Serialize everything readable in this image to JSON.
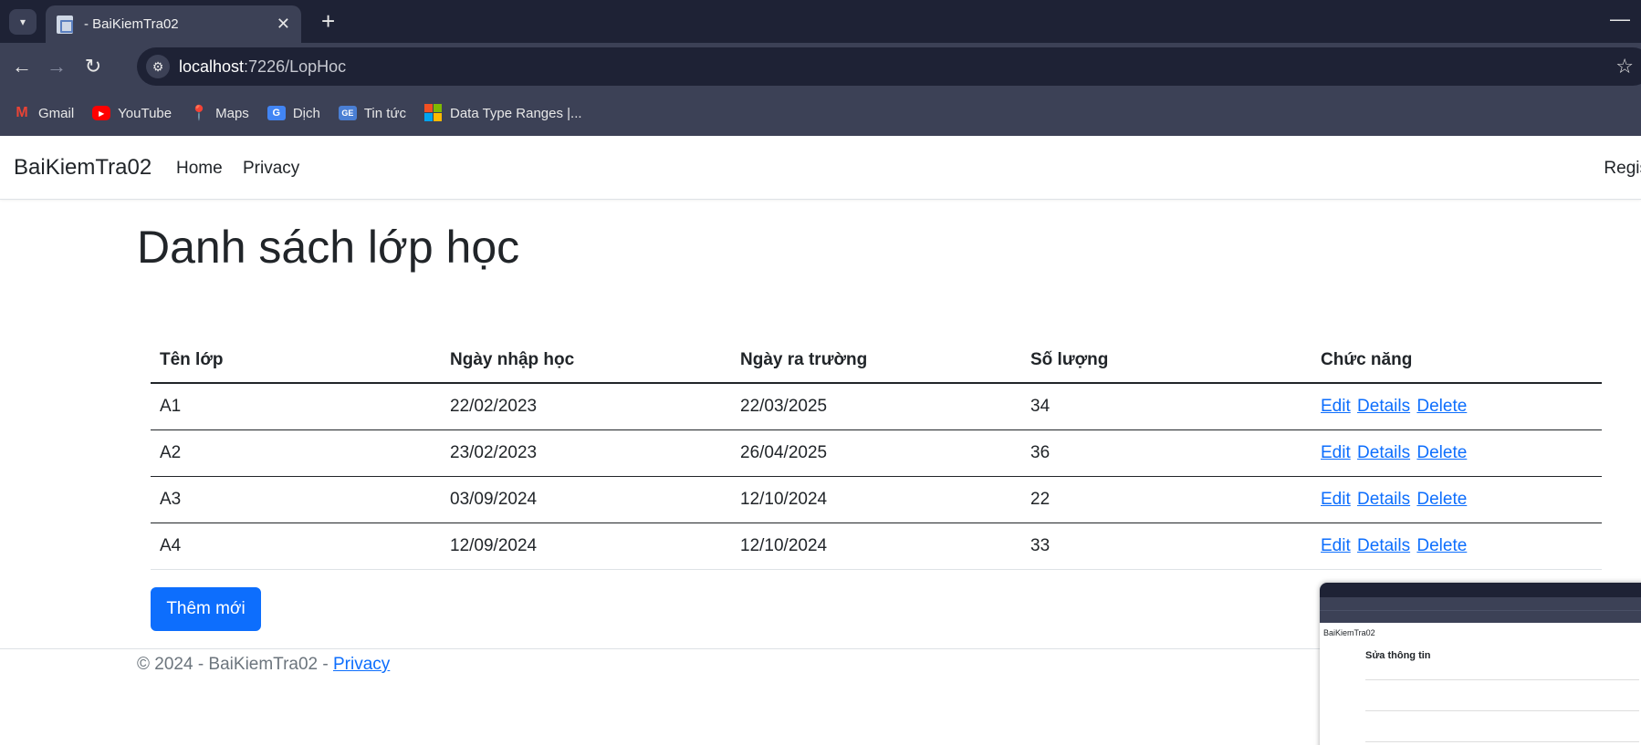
{
  "browser": {
    "tab_title": "- BaiKiemTra02",
    "url_host": "localhost",
    "url_rest": ":7226/LopHoc",
    "bookmarks": [
      "Gmail",
      "YouTube",
      "Maps",
      "Dịch",
      "Tin tức",
      "Data Type Ranges |..."
    ]
  },
  "navbar": {
    "brand": "BaiKiemTra02",
    "links": [
      "Home",
      "Privacy"
    ],
    "right": "Regis"
  },
  "page": {
    "title": "Danh sách lớp học"
  },
  "table": {
    "headers": [
      "Tên lớp",
      "Ngày nhập học",
      "Ngày ra trường",
      "Số lượng",
      "Chức năng"
    ],
    "rows": [
      {
        "name": "A1",
        "start": "22/02/2023",
        "end": "22/03/2025",
        "count": "34"
      },
      {
        "name": "A2",
        "start": "23/02/2023",
        "end": "26/04/2025",
        "count": "36"
      },
      {
        "name": "A3",
        "start": "03/09/2024",
        "end": "12/10/2024",
        "count": "22"
      },
      {
        "name": "A4",
        "start": "12/09/2024",
        "end": "12/10/2024",
        "count": "33"
      }
    ],
    "actions": {
      "edit": "Edit",
      "details": "Details",
      "delete": "Delete"
    }
  },
  "add_button": "Thêm mới",
  "footer": {
    "text": "© 2024 - BaiKiemTra02 - ",
    "link": "Privacy"
  },
  "thumbnail": {
    "brand": "BaiKiemTra02",
    "heading": "Sửa thông tin"
  }
}
